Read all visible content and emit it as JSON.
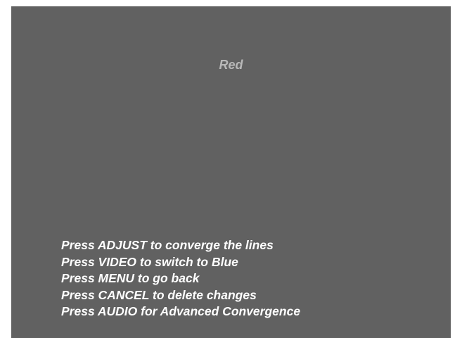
{
  "screen": {
    "title": "Red",
    "background_color": "#616161",
    "title_color": "#b8b8b8",
    "text_color": "#ffffff"
  },
  "instructions": [
    "Press ADJUST to converge the lines",
    "Press VIDEO to switch to Blue",
    "Press MENU to go back",
    "Press CANCEL to delete changes",
    "Press AUDIO for Advanced Convergence"
  ]
}
